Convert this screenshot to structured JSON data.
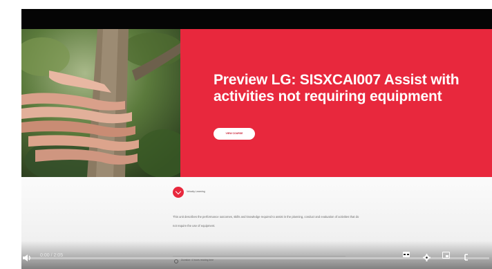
{
  "slide": {
    "title": "Preview LG: SISXCAI007 Assist with activities not requiring equipment",
    "button_label": "VIEW COURSE",
    "logo_text": "Velocity Learning",
    "description": "This unit describes the performance outcomes, skills and knowledge required to assist in the planning, conduct and evaluation of activities that do not require the use of equipment.",
    "duration": "Duration: 4 hours reading time"
  },
  "player": {
    "time": "0:00 / 2:05",
    "progress": 0,
    "icons": [
      "play-icon",
      "volume-icon",
      "subtitles-icon",
      "gear-icon",
      "miniplayer-icon",
      "fullscreen-icon"
    ]
  },
  "colors": {
    "hero_red": "#e8283d",
    "letterbox": "#050505",
    "lower_panel": "#f5f5f5"
  }
}
